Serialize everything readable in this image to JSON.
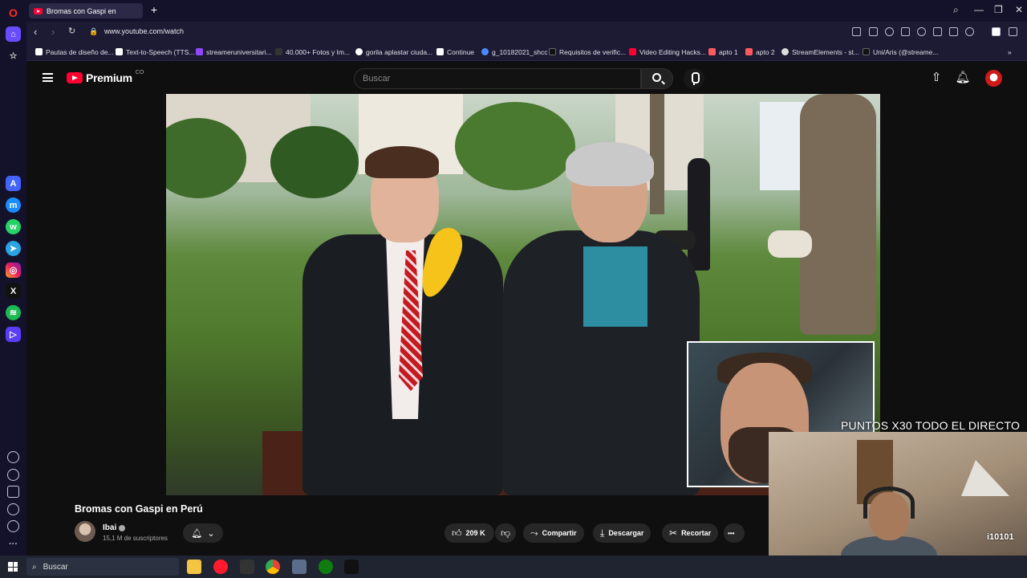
{
  "browser": {
    "tab_title": "Bromas con Gaspi en",
    "url": "www.youtube.com/watch"
  },
  "bookmarks": [
    "Pautas de diseño de...",
    "Text-to-Speech (TTS...",
    "streameruniversitari...",
    "40.000+ Fotos y Im...",
    "gorila aplastar ciuda...",
    "Continue",
    "g_10182021_shcc",
    "Requisitos de verific...",
    "Video Editing Hacks...",
    "apto 1",
    "apto 2",
    "StreamElements - st...",
    "Uni/Aris (@streame..."
  ],
  "youtube": {
    "brand": "Premium",
    "region": "CO",
    "search_placeholder": "Buscar",
    "video_title": "Bromas con Gaspi en Perú",
    "channel_name": "Ibai",
    "subscribers": "15,1 M de suscriptores",
    "likes": "209 K",
    "share": "Compartir",
    "download": "Descargar",
    "clip": "Recortar",
    "more": "•••"
  },
  "overlay": {
    "points_text": "PUNTOS X30 TODO EL DIRECTO",
    "tag": "i10101"
  },
  "taskbar": {
    "search": "Buscar"
  },
  "colors": {
    "youtube_red": "#ff0033",
    "browser_bg": "#14122a",
    "page_bg": "#0f0f0f"
  }
}
